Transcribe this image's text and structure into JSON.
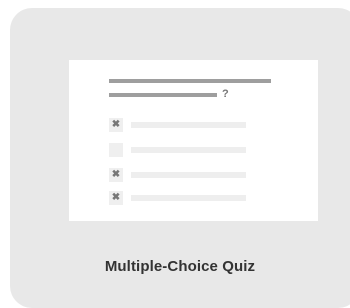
{
  "card": {
    "label": "Multiple-Choice Quiz",
    "background_color": "#e8e8e8"
  },
  "preview": {
    "question_mark": "?",
    "options": [
      {
        "marker": "✖",
        "state": "incorrect"
      },
      {
        "marker": "",
        "state": "empty"
      },
      {
        "marker": "✖",
        "state": "incorrect"
      },
      {
        "marker": "✖",
        "state": "incorrect"
      }
    ]
  }
}
